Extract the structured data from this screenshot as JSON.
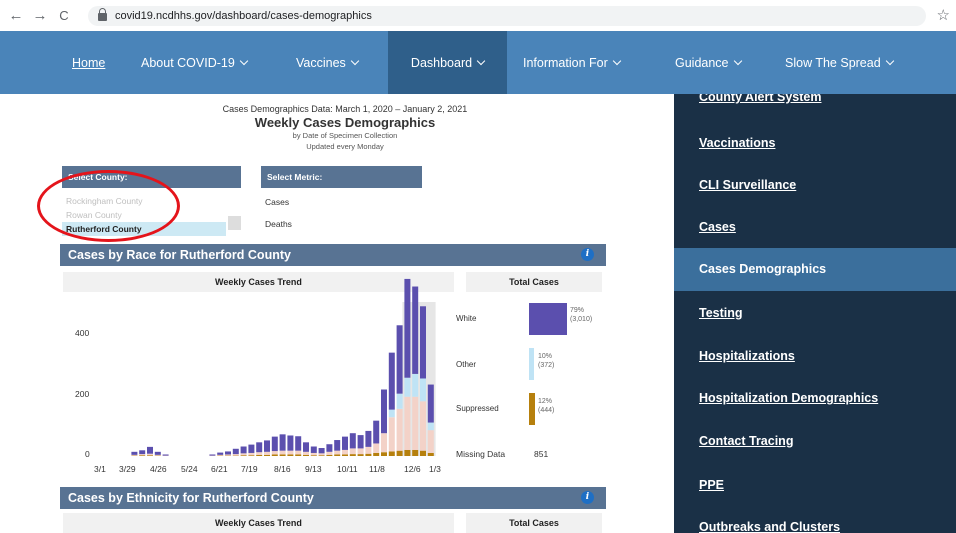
{
  "browser": {
    "back": "←",
    "forward": "→",
    "reload": "C",
    "url": "covid19.ncdhhs.gov/dashboard/cases-demographics",
    "star": "☆"
  },
  "nav": {
    "items": [
      {
        "label": "Home"
      },
      {
        "label": "About COVID-19"
      },
      {
        "label": "Vaccines"
      },
      {
        "label": "Dashboard"
      },
      {
        "label": "Information For"
      },
      {
        "label": "Guidance"
      },
      {
        "label": "Slow The Spread"
      }
    ],
    "active": "Dashboard"
  },
  "sidebar": {
    "items": [
      {
        "label": "County Alert System"
      },
      {
        "label": "Vaccinations"
      },
      {
        "label": "CLI Surveillance"
      },
      {
        "label": "Cases"
      },
      {
        "label": "Cases Demographics"
      },
      {
        "label": "Testing"
      },
      {
        "label": "Hospitalizations"
      },
      {
        "label": "Hospitalization Demographics"
      },
      {
        "label": "Contact Tracing"
      },
      {
        "label": "PPE"
      },
      {
        "label": "Outbreaks and Clusters"
      }
    ],
    "active": "Cases Demographics"
  },
  "headline": {
    "range": "Cases Demographics Data: March 1, 2020 – January 2, 2021",
    "title": "Weekly Cases Demographics",
    "sub1": "by Date of Specimen Collection",
    "sub2": "Updated every Monday"
  },
  "county_select": {
    "label": "Select County:",
    "options": [
      "Rockingham County",
      "Rowan County",
      "Rutherford County"
    ],
    "selected": "Rutherford County"
  },
  "metric_select": {
    "label": "Select Metric:",
    "options": [
      "Cases",
      "Deaths"
    ]
  },
  "race_section": {
    "title": "Cases by Race for Rutherford County",
    "trend_header": "Weekly Cases Trend",
    "total_header": "Total Cases",
    "totals": [
      {
        "category": "White",
        "pct": "79%",
        "count": "(3,010)",
        "fraction": 0.79,
        "color": "#5b4fae"
      },
      {
        "category": "Other",
        "pct": "10%",
        "count": "(372)",
        "fraction": 0.1,
        "color": "#bfe3f5"
      },
      {
        "category": "Suppressed",
        "pct": "12%",
        "count": "(444)",
        "fraction": 0.12,
        "color": "#b6800d"
      }
    ],
    "missing_label": "Missing Data",
    "missing_value": "851"
  },
  "ethnicity_section": {
    "title": "Cases by Ethnicity for Rutherford County",
    "trend_header": "Weekly Cases Trend",
    "total_header": "Total Cases"
  },
  "chart_data": {
    "type": "bar",
    "stacked": true,
    "xticks": [
      "3/1",
      "3/29",
      "4/26",
      "5/24",
      "6/21",
      "7/19",
      "8/16",
      "9/13",
      "10/11",
      "11/8",
      "12/6",
      "1/3"
    ],
    "yticks": [
      "400",
      "200",
      "0"
    ],
    "ylim": [
      0,
      520
    ],
    "series": [
      {
        "name": "White",
        "color": "#5b4fae",
        "values": [
          0,
          0,
          0,
          8,
          10,
          18,
          8,
          3,
          0,
          0,
          0,
          0,
          0,
          3,
          6,
          8,
          14,
          18,
          22,
          26,
          30,
          38,
          43,
          40,
          38,
          25,
          17,
          14,
          20,
          28,
          35,
          40,
          35,
          42,
          60,
          115,
          150,
          180,
          260,
          230,
          190,
          100
        ]
      },
      {
        "name": "Other",
        "color": "#bfe3f5",
        "values": [
          0,
          0,
          0,
          0,
          0,
          0,
          0,
          0,
          0,
          0,
          0,
          0,
          0,
          0,
          0,
          0,
          0,
          0,
          0,
          0,
          0,
          0,
          0,
          0,
          0,
          0,
          0,
          0,
          0,
          0,
          0,
          0,
          0,
          0,
          0,
          0,
          20,
          40,
          50,
          60,
          60,
          20
        ]
      },
      {
        "name": "Suppressed",
        "color": "#b6800d",
        "values": [
          0,
          0,
          0,
          1,
          2,
          2,
          1,
          0,
          0,
          0,
          0,
          0,
          0,
          0,
          1,
          1,
          1,
          2,
          2,
          3,
          3,
          4,
          4,
          4,
          4,
          3,
          2,
          2,
          3,
          4,
          4,
          5,
          5,
          6,
          8,
          10,
          12,
          14,
          16,
          16,
          14,
          8
        ]
      },
      {
        "name": "Missing Data",
        "color": "#f3d2c8",
        "values": [
          0,
          0,
          0,
          2,
          3,
          4,
          2,
          1,
          0,
          0,
          0,
          0,
          0,
          1,
          2,
          3,
          4,
          5,
          6,
          7,
          8,
          9,
          10,
          10,
          10,
          8,
          6,
          5,
          8,
          10,
          12,
          15,
          15,
          18,
          25,
          50,
          90,
          110,
          140,
          140,
          130,
          60
        ]
      }
    ]
  }
}
